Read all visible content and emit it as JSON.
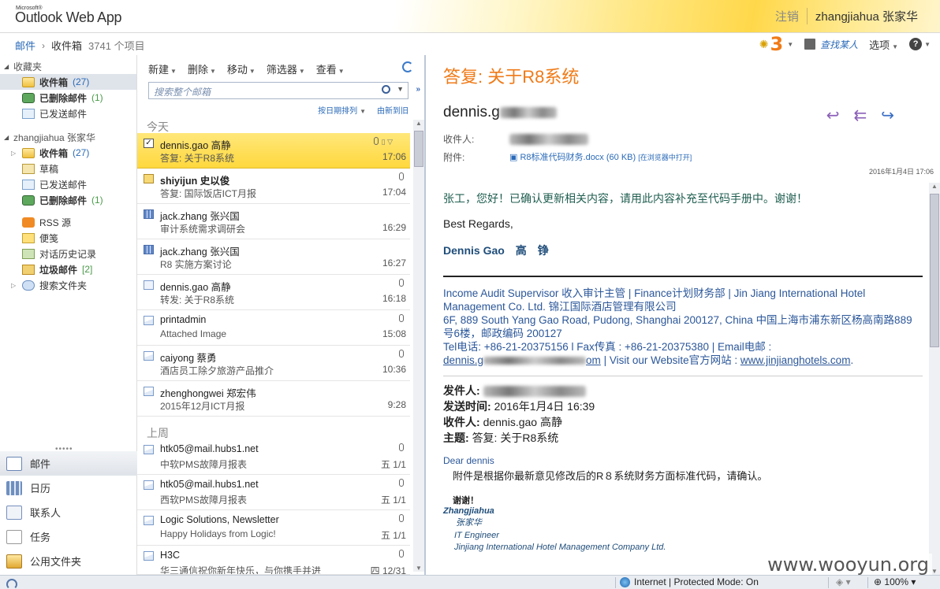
{
  "header": {
    "brand_small": "Microsoft®",
    "brand": "Outlook Web App",
    "signout": "注销",
    "user": "zhangjiahua 张家华"
  },
  "breadcrumb": {
    "root": "邮件",
    "current": "收件箱",
    "count": "3741 个项目"
  },
  "topright": {
    "alerts": "3",
    "find_people": "查找某人",
    "options": "选项",
    "help": "?"
  },
  "nav": {
    "favorites_label": "收藏夹",
    "favorites": [
      {
        "label": "收件箱",
        "count": "(27)"
      },
      {
        "label": "已删除邮件",
        "count": "(1)"
      },
      {
        "label": "已发送邮件",
        "count": ""
      }
    ],
    "mailbox_label": "zhangjiahua 张家华",
    "folders": [
      {
        "label": "收件箱",
        "count": "(27)"
      },
      {
        "label": "草稿",
        "count": ""
      },
      {
        "label": "已发送邮件",
        "count": ""
      },
      {
        "label": "已删除邮件",
        "count": "(1)"
      },
      {
        "label": "RSS 源",
        "count": ""
      },
      {
        "label": "便笺",
        "count": ""
      },
      {
        "label": "对话历史记录",
        "count": ""
      },
      {
        "label": "垃圾邮件",
        "count": "[2]"
      },
      {
        "label": "搜索文件夹",
        "count": ""
      }
    ],
    "modules": [
      "邮件",
      "日历",
      "联系人",
      "任务",
      "公用文件夹"
    ]
  },
  "list": {
    "toolbar": [
      "新建",
      "删除",
      "移动",
      "筛选器",
      "查看"
    ],
    "search_placeholder": "搜索整个邮箱",
    "sort_by": "按日期排列",
    "sort_order": "由新到旧",
    "group_today": "今天",
    "group_lastweek": "上周",
    "messages": [
      {
        "from": "dennis.gao 高静",
        "subject": "答复: 关于R8系统",
        "time": "17:06"
      },
      {
        "from": "shiyijun 史以俊",
        "subject": "答复: 国际饭店ICT月报",
        "time": "17:04"
      },
      {
        "from": "jack.zhang 张兴国",
        "subject": "审计系统需求调研会",
        "time": "16:29"
      },
      {
        "from": "jack.zhang 张兴国",
        "subject": "R8 实施方案讨论",
        "time": "16:27"
      },
      {
        "from": "dennis.gao 高静",
        "subject": "转发: 关于R8系统",
        "time": "16:18"
      },
      {
        "from": "printadmin",
        "subject": "Attached Image",
        "time": "15:08"
      },
      {
        "from": "caiyong 蔡勇",
        "subject": "酒店员工除夕旅游产品推介",
        "time": "10:36"
      },
      {
        "from": "zhenghongwei 郑宏伟",
        "subject": "2015年12月ICT月报",
        "time": "9:28"
      },
      {
        "from": "htk05@mail.hubs1.net",
        "subject": "中软PMS故障月报表",
        "time": "五 1/1"
      },
      {
        "from": "htk05@mail.hubs1.net",
        "subject": "西软PMS故障月报表",
        "time": "五 1/1"
      },
      {
        "from": "Logic Solutions, Newsletter",
        "subject": "Happy Holidays from Logic!",
        "time": "五 1/1"
      },
      {
        "from": "H3C",
        "subject": "华三通信祝你新年快乐，与你携手并进",
        "time": "四 12/31"
      }
    ]
  },
  "reading": {
    "title": "答复: 关于R8系统",
    "from": "dennis.g",
    "to_label": "收件人:",
    "attach_label": "附件:",
    "attachment": "R8标准代码财务.docx (60 KB)",
    "open_in_browser": "[在浏览器中打开]",
    "date": "2016年1月4日 17:06",
    "greeting": "张工，您好！已确认更新相关内容，请用此内容补充至代码手册中。谢谢！",
    "regards": "Best Regards,",
    "sig_name": "Dennis Gao　高　铮",
    "sig_line1": "Income Audit Supervisor 收入审计主管 | Finance计划财务部 | Jin Jiang International Hotel Management Co. Ltd. 锦江国际酒店管理有限公司",
    "sig_line2": "6F, 889 South Yang Gao Road, Pudong, Shanghai 200127, China 中国上海市浦东新区杨高南路889号6楼，邮政编码 200127",
    "sig_line3": "Tel电话: +86-21-20375156 l Fax传真 : +86-21-20375380 | Email电邮 :",
    "sig_email_start": "dennis.g",
    "sig_email_end": "om",
    "sig_web_label": " | Visit our Website官方网站 : ",
    "sig_web": "www.jinjianghotels.com",
    "q_from_label": "发件人:",
    "q_sent_label": "发送时间:",
    "q_sent": "2016年1月4日 16:39",
    "q_to_label": "收件人:",
    "q_to": "dennis.gao 高静",
    "q_subject_label": "主题:",
    "q_subject": "答复: 关于R8系统",
    "dear": "Dear dennis",
    "para": "附件是根据你最新意见修改后的R８系统财务方面标准代码，请确认。",
    "thanks": "谢谢！",
    "q_sig1": "Zhangjiahua",
    "q_sig2": "张家华",
    "q_sig3": "IT Engineer",
    "q_sig4": "Jinjiang International Hotel Management Company Ltd."
  },
  "watermark": "www.wooyun.org",
  "status": {
    "zone": "Internet | Protected Mode: On",
    "zoom": "100%"
  }
}
